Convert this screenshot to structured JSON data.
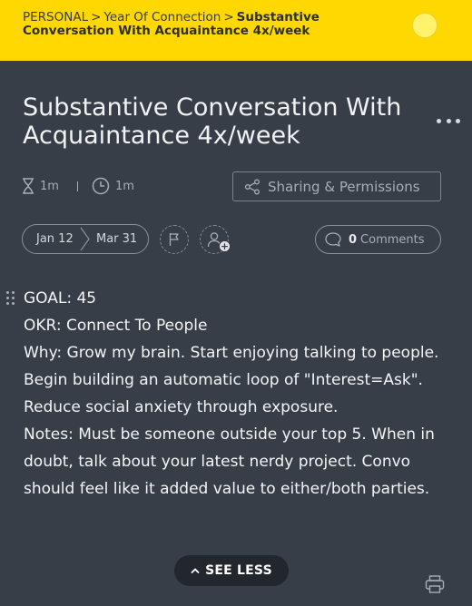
{
  "breadcrumb": {
    "root": "PERSONAL",
    "parent": "Year Of Connection",
    "current": "Substantive Conversation With Acquaintance 4x/week",
    "separator": ">"
  },
  "title": "Substantive Conversation With Acquaintance 4x/week",
  "meta": {
    "estimate_icon": "hourglass-icon",
    "estimate": "1m",
    "tracked_icon": "clock-icon",
    "tracked": "1m"
  },
  "sharing": {
    "icon": "share-icon",
    "label": "Sharing & Permissions"
  },
  "dates": {
    "start": "Jan 12",
    "end": "Mar 31"
  },
  "comments": {
    "count": "0",
    "label": "Comments"
  },
  "description": {
    "lines": [
      "GOAL: 45",
      "OKR: Connect To People",
      "Why: Grow my brain. Start enjoying talking to people. Begin building an automatic loop of \"Interest=Ask\". Reduce social anxiety through exposure.",
      "Notes: Must be someone outside your top 5. When in doubt, talk about your latest nerdy project. Convo should feel like it added value to either/both parties."
    ]
  },
  "see_less_label": "SEE LESS",
  "colors": {
    "header_bg": "#fed800",
    "page_bg": "#383e47",
    "avatar": "#fff36d",
    "button_dark": "#22272e"
  }
}
